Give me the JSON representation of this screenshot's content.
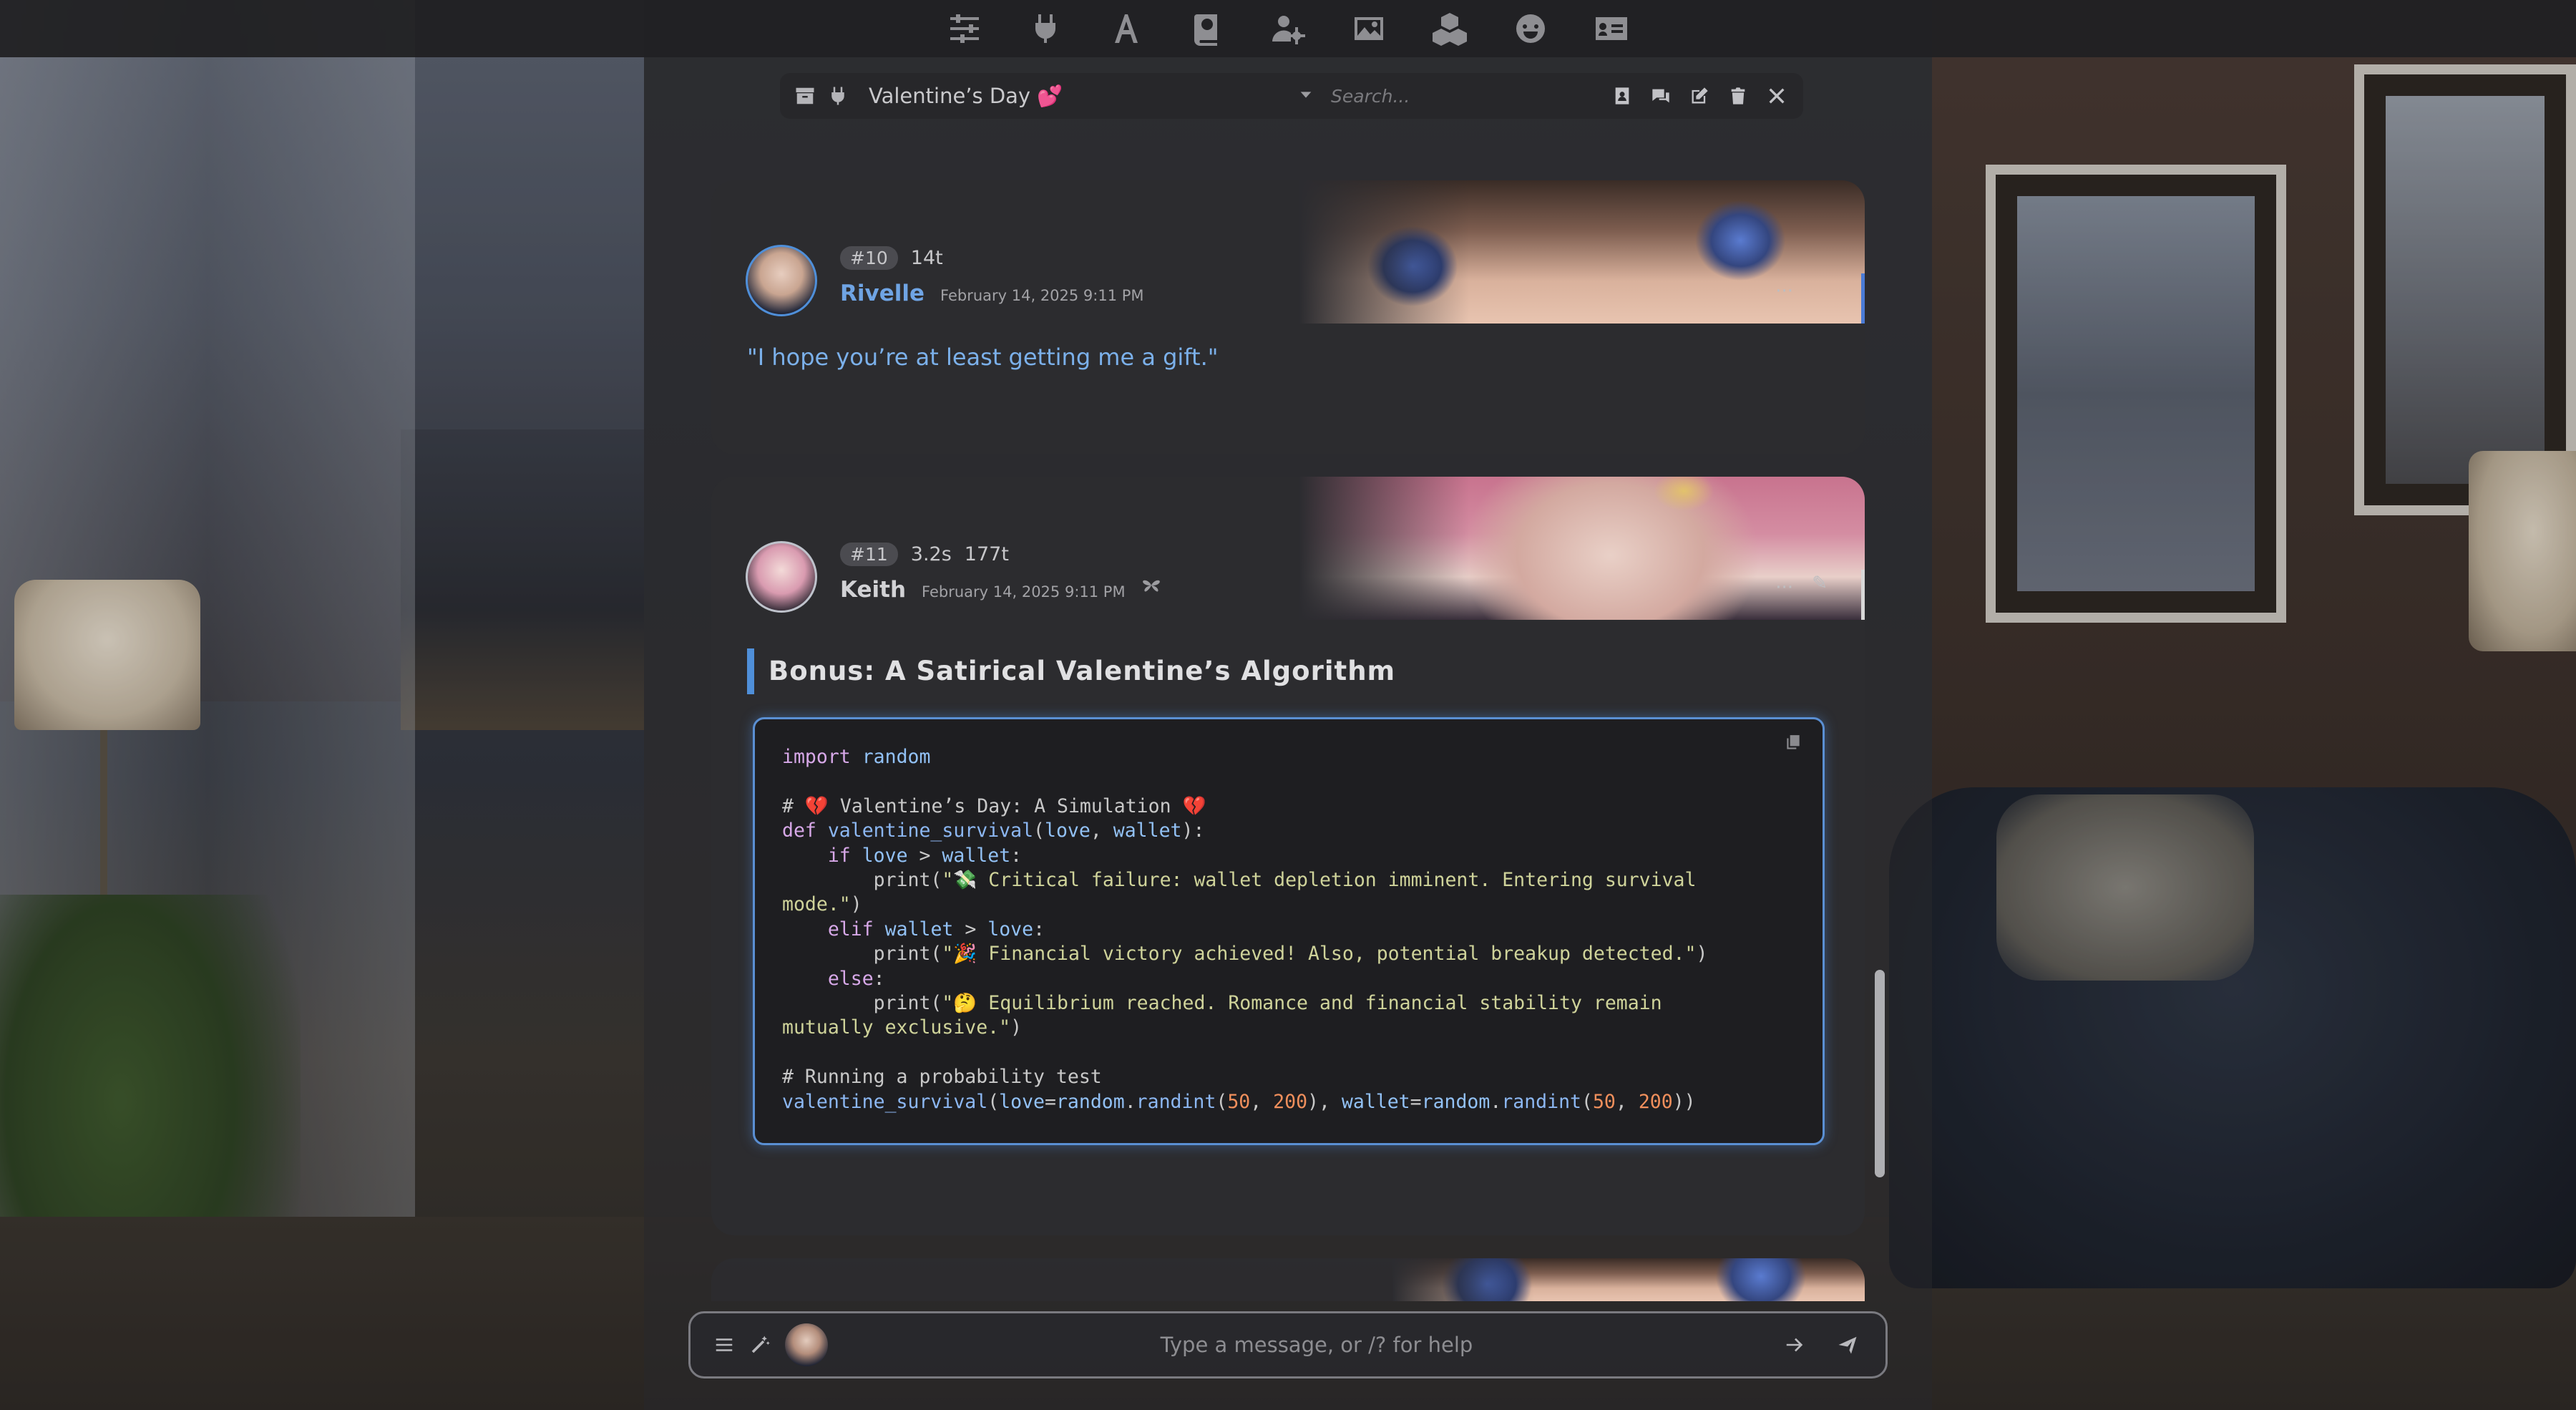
{
  "toolbar": {
    "icons": [
      "sliders-icon",
      "plug-icon",
      "font-icon",
      "book-icon",
      "user-gear-icon",
      "image-icon",
      "cubes-icon",
      "smile-icon",
      "id-card-icon"
    ]
  },
  "chat_bar": {
    "chat_name": "Valentine’s Day 💕",
    "search_placeholder": "Search..."
  },
  "messages": [
    {
      "id": "#10",
      "tokens": "14t",
      "name": "Rivelle",
      "timestamp": "February 14, 2025 9:11 PM",
      "text": "\"I hope you’re at least getting me a gift.\"",
      "name_color": "#6fa4e4"
    },
    {
      "id": "#11",
      "time": "3.2s",
      "tokens": "177t",
      "name": "Keith",
      "timestamp": "February 14, 2025 9:11 PM",
      "heading": "Bonus: A Satirical Valentine’s Algorithm"
    }
  ],
  "input": {
    "placeholder": "Type a message, or /? for help"
  },
  "colors": {
    "accent": "#4f8fd9",
    "code_keyword": "#d7a8e8",
    "code_string": "#cfd39a",
    "code_number": "#f08f5c"
  }
}
